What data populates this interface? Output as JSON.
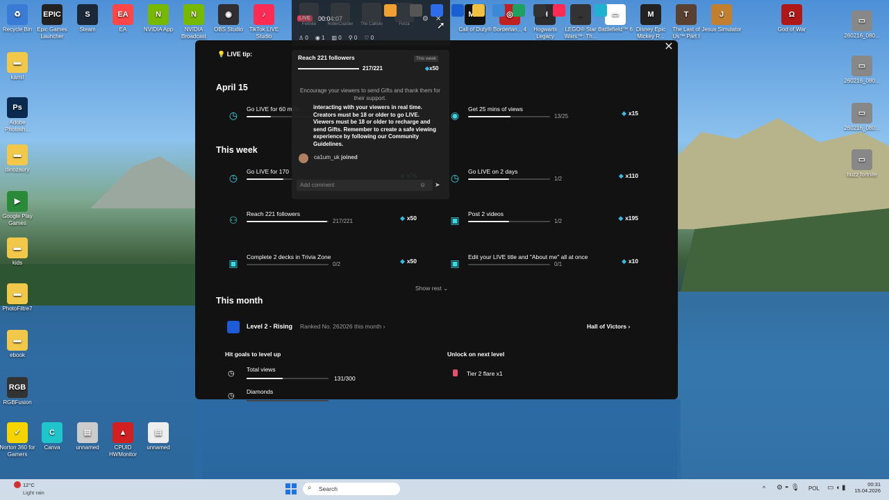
{
  "desktop": {
    "top_icons": [
      {
        "label": "Recycle Bin",
        "color": "#3a7bd5",
        "glyph": "♻"
      },
      {
        "label": "Epic Games Launcher",
        "color": "#222",
        "glyph": "EPIC"
      },
      {
        "label": "Steam",
        "color": "#1b2838",
        "glyph": "S"
      },
      {
        "label": "EA",
        "color": "#ff4747",
        "glyph": "EA"
      },
      {
        "label": "NVIDIA App",
        "color": "#76b900",
        "glyph": "N"
      },
      {
        "label": "NVIDIA Broadcast",
        "color": "#76b900",
        "glyph": "N"
      },
      {
        "label": "OBS Studio",
        "color": "#302e31",
        "glyph": "◉"
      },
      {
        "label": "TikTok LIVE Studio",
        "color": "#fe2c55",
        "glyph": "♪"
      },
      {
        "label": "Call of Duty®",
        "color": "#111",
        "glyph": "MW"
      },
      {
        "label": "Borderlan... 4",
        "color": "#c02020",
        "glyph": "◎"
      },
      {
        "label": "Hogwarts Legacy",
        "color": "#2b2b2b",
        "glyph": "H"
      },
      {
        "label": "LEGO® Star Wars™: Th...",
        "color": "#333",
        "glyph": "L"
      },
      {
        "label": "Battlefield™ 6",
        "color": "#fff",
        "glyph": "▭"
      },
      {
        "label": "Disney Epic Mickey R...",
        "color": "#222",
        "glyph": "M"
      },
      {
        "label": "The Last of Us™ Part I",
        "color": "#5a4030",
        "glyph": "T"
      },
      {
        "label": "Jesus Simulator",
        "color": "#c08030",
        "glyph": "J"
      },
      {
        "label": "God of War",
        "color": "#b01818",
        "glyph": "Ω"
      }
    ],
    "left_icons": [
      {
        "label": "kamil",
        "color": "#f2c84b",
        "glyph": "▬"
      },
      {
        "label": "Adobe Photosh...",
        "color": "#0a2a50",
        "glyph": "Ps"
      },
      {
        "label": "dinozaury",
        "color": "#f2c84b",
        "glyph": "▬"
      },
      {
        "label": "Google Play Games",
        "color": "#2a8a3a",
        "glyph": "▶"
      },
      {
        "label": "kids",
        "color": "#f2c84b",
        "glyph": "▬"
      },
      {
        "label": "PhotoFiltre7",
        "color": "#f2c84b",
        "glyph": "▬"
      },
      {
        "label": "ebook",
        "color": "#f2c84b",
        "glyph": "▬"
      },
      {
        "label": "RGBFusion",
        "color": "#333",
        "glyph": "RGB"
      }
    ],
    "bottom_icons": [
      {
        "label": "Norton 360 for Gamers",
        "color": "#f5d400",
        "glyph": "✓"
      },
      {
        "label": "Canva",
        "color": "#20c4cb",
        "glyph": "C"
      },
      {
        "label": "unnamed",
        "color": "#ccc",
        "glyph": "▤"
      },
      {
        "label": "CPUID HWMonitor",
        "color": "#d02020",
        "glyph": "▲"
      },
      {
        "label": "unnamed",
        "color": "#eee",
        "glyph": "▤"
      }
    ],
    "right_icons": [
      {
        "label": "260216_080...",
        "color": "#888",
        "glyph": "▭"
      },
      {
        "label": "260216_080...",
        "color": "#888",
        "glyph": "▭"
      },
      {
        "label": "260216_080...",
        "color": "#888",
        "glyph": "▭"
      },
      {
        "label": "buzz fortnite",
        "color": "#888",
        "glyph": "▭"
      }
    ]
  },
  "overlay": {
    "live_badge": "LIVE",
    "timer": "00:04:07",
    "stats": [
      "0",
      "1",
      "0",
      "0",
      "0"
    ],
    "game_tiles": [
      "Fortnite",
      "RollerCoaster",
      "The Callisto",
      "Forza"
    ],
    "goal_title": "Reach 221 followers",
    "goal_tag": "This week",
    "goal_progress": "217/221",
    "goal_reward": "x50",
    "tip": "Encourage your viewers to send Gifts and thank them for their support.",
    "message": "interacting with your viewers in real time. Creators must be 18 or older to go LIVE. Viewers must be 18 or older to recharge and send Gifts. Remember to create a safe viewing experience by following our Community Guidelines.",
    "joined_user": "ca1um_uk",
    "joined_text": "joined",
    "comment_placeholder": "Add comment"
  },
  "panel": {
    "live_tip": "LIVE tip:",
    "sections": {
      "day": "April 15",
      "week": "This week",
      "month": "This month"
    },
    "day_tasks": [
      {
        "name": "Go LIVE for 60 mins",
        "progress": "",
        "reward": "",
        "fill": 0.3
      },
      {
        "name": "Get 25 mins of views",
        "progress": "13/25",
        "reward": "x15",
        "fill": 0.52
      }
    ],
    "week_tasks": [
      {
        "name": "Go LIVE for 170",
        "progress": "",
        "reward": "x75",
        "fill": 0.45
      },
      {
        "name": "Go LIVE on 2 days",
        "progress": "1/2",
        "reward": "x110",
        "fill": 0.5
      },
      {
        "name": "Reach 221 followers",
        "progress": "217/221",
        "reward": "x50",
        "fill": 0.98
      },
      {
        "name": "Post 2 videos",
        "progress": "1/2",
        "reward": "x195",
        "fill": 0.5
      },
      {
        "name": "Complete 2 decks in Trivia Zone",
        "progress": "0/2",
        "reward": "x50",
        "fill": 0
      },
      {
        "name": "Edit your LIVE title and \"About me\" all at once",
        "progress": "0/1",
        "reward": "x10",
        "fill": 0
      }
    ],
    "show_rest": "Show rest",
    "level": {
      "name": "Level 2 - Rising",
      "rank": "Ranked No. 262026 this month",
      "hall": "Hall of Victors"
    },
    "hit_goals": "Hit goals to level up",
    "unlock": "Unlock on next level",
    "unlock_item": "Tier 2 flare x1",
    "goals": [
      {
        "name": "Total views",
        "progress": "131/300",
        "fill": 0.44
      },
      {
        "name": "Diamonds",
        "progress": "",
        "fill": 0
      }
    ]
  },
  "taskbar": {
    "weather_temp": "12°C",
    "weather_desc": "Light rain",
    "search": "Search",
    "lang": "POL",
    "time": "00:31",
    "date": "15.04.2026"
  }
}
